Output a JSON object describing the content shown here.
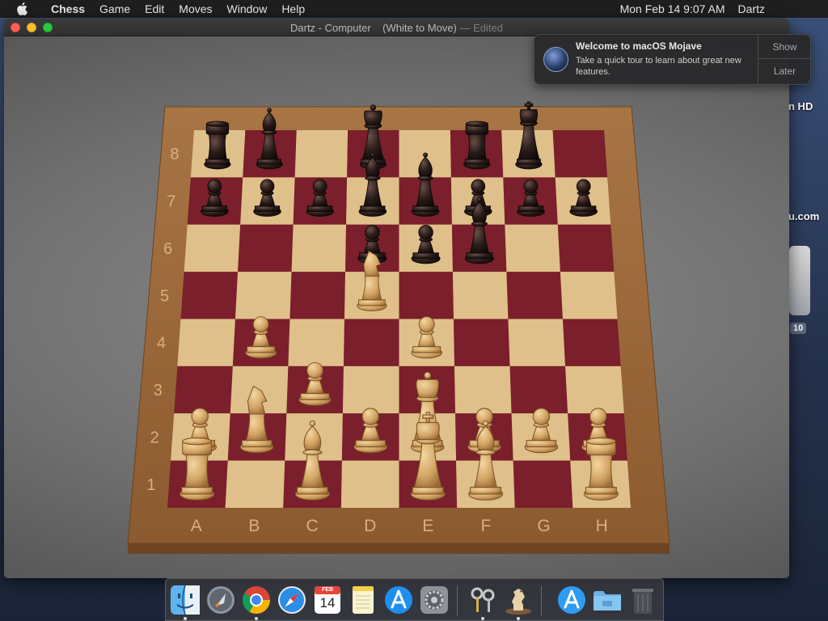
{
  "menubar": {
    "app_name": "Chess",
    "items": [
      "Game",
      "Edit",
      "Moves",
      "Window",
      "Help"
    ],
    "datetime": "Mon Feb 14  9:07 AM",
    "user": "Dartz"
  },
  "window": {
    "title_main": "Dartz - Computer    (White to Move)",
    "title_edited": "— Edited"
  },
  "board": {
    "files": [
      "A",
      "B",
      "C",
      "D",
      "E",
      "F",
      "G",
      "H"
    ],
    "ranks": [
      "8",
      "7",
      "6",
      "5",
      "4",
      "3",
      "2",
      "1"
    ],
    "light_square_color": "#e0c08a",
    "dark_square_color": "#7a1f2b",
    "frame_color": "#9b6a3c",
    "white_piece_color": "#d2a464",
    "black_piece_color": "#2a1d1a",
    "pieces": [
      {
        "square": "a8",
        "color": "black",
        "type": "rook"
      },
      {
        "square": "b8",
        "color": "black",
        "type": "bishop"
      },
      {
        "square": "d8",
        "color": "black",
        "type": "queen"
      },
      {
        "square": "f8",
        "color": "black",
        "type": "rook"
      },
      {
        "square": "g8",
        "color": "black",
        "type": "king"
      },
      {
        "square": "a7",
        "color": "black",
        "type": "pawn"
      },
      {
        "square": "b7",
        "color": "black",
        "type": "pawn"
      },
      {
        "square": "c7",
        "color": "black",
        "type": "pawn"
      },
      {
        "square": "d7",
        "color": "black",
        "type": "bishop"
      },
      {
        "square": "e7",
        "color": "black",
        "type": "bishop"
      },
      {
        "square": "f7",
        "color": "black",
        "type": "pawn"
      },
      {
        "square": "g7",
        "color": "black",
        "type": "pawn"
      },
      {
        "square": "h7",
        "color": "black",
        "type": "pawn"
      },
      {
        "square": "d6",
        "color": "black",
        "type": "pawn"
      },
      {
        "square": "e6",
        "color": "black",
        "type": "pawn"
      },
      {
        "square": "f6",
        "color": "black",
        "type": "bishop"
      },
      {
        "square": "d5",
        "color": "white",
        "type": "knight"
      },
      {
        "square": "b4",
        "color": "white",
        "type": "pawn"
      },
      {
        "square": "e4",
        "color": "white",
        "type": "pawn"
      },
      {
        "square": "c3",
        "color": "white",
        "type": "pawn"
      },
      {
        "square": "a2",
        "color": "white",
        "type": "pawn"
      },
      {
        "square": "b2",
        "color": "white",
        "type": "knight"
      },
      {
        "square": "d2",
        "color": "white",
        "type": "pawn"
      },
      {
        "square": "e2",
        "color": "white",
        "type": "queen"
      },
      {
        "square": "f2",
        "color": "white",
        "type": "pawn"
      },
      {
        "square": "g2",
        "color": "white",
        "type": "pawn"
      },
      {
        "square": "h2",
        "color": "white",
        "type": "pawn"
      },
      {
        "square": "a1",
        "color": "white",
        "type": "rook"
      },
      {
        "square": "c1",
        "color": "white",
        "type": "bishop"
      },
      {
        "square": "e1",
        "color": "white",
        "type": "king"
      },
      {
        "square": "f1",
        "color": "white",
        "type": "bishop"
      },
      {
        "square": "h1",
        "color": "white",
        "type": "rook"
      }
    ]
  },
  "notification": {
    "title": "Welcome to macOS Mojave",
    "body": "Take a quick tour to learn about great new features.",
    "show_label": "Show",
    "later_label": "Later"
  },
  "desktop": {
    "items": [
      "n HD",
      "u.com"
    ],
    "badge": "10"
  },
  "dock": {
    "icons": [
      "finder-icon",
      "launchpad-icon",
      "chrome-icon",
      "safari-icon",
      "calendar-icon",
      "notes-icon",
      "app-store-icon",
      "system-preferences-icon",
      "keychain-icon",
      "chess-icon",
      "app-store-download-icon",
      "folder-icon",
      "trash-icon"
    ],
    "calendar": {
      "month": "FEB",
      "day": "14"
    }
  }
}
